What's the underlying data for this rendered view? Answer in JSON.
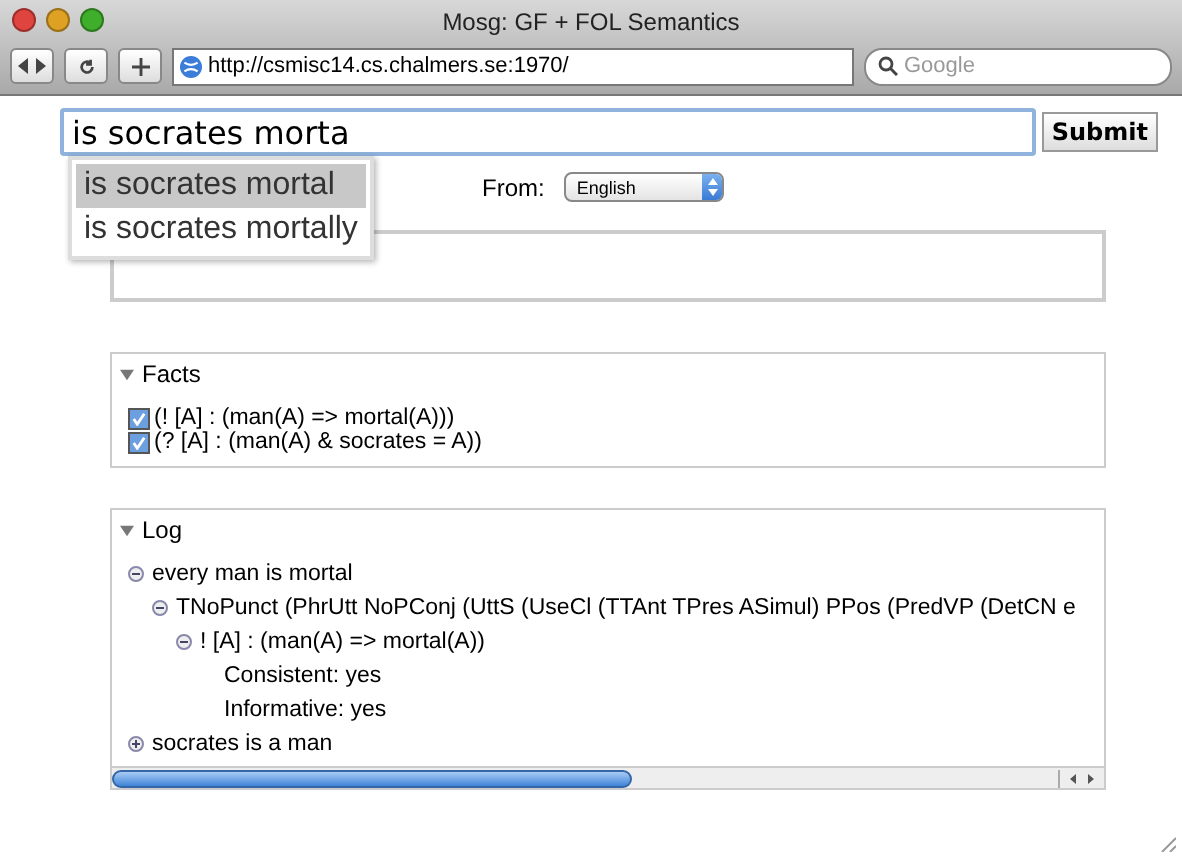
{
  "window": {
    "title": "Mosg: GF + FOL Semantics"
  },
  "toolbar": {
    "url": "http://csmisc14.cs.chalmers.se:1970/",
    "search": {
      "placeholder": "Google"
    }
  },
  "query": {
    "value": "is socrates morta",
    "submit": "Submit"
  },
  "suggestions": [
    {
      "text": "is socrates mortal",
      "selected": true
    },
    {
      "text": "is socrates mortally",
      "selected": false
    }
  ],
  "from": {
    "label": "From:",
    "value": "English"
  },
  "facts": {
    "title": "Facts",
    "expanded": true,
    "items": [
      {
        "text": "(! [A] : (man(A) => mortal(A)))",
        "checked": true
      },
      {
        "text": "(? [A] : (man(A) & socrates = A))",
        "checked": true
      }
    ]
  },
  "log": {
    "title": "Log",
    "expanded": true,
    "items": [
      {
        "text": "every man is mortal",
        "expanded": true,
        "children": [
          {
            "text": "TNoPunct (PhrUtt NoPConj (UttS (UseCl (TTAnt TPres ASimul) PPos (PredVP (DetCN e",
            "expanded": true,
            "children": [
              {
                "text": "! [A] : (man(A) => mortal(A))",
                "expanded": true,
                "children": [
                  {
                    "text": "Consistent: yes"
                  },
                  {
                    "text": "Informative: yes"
                  }
                ]
              }
            ]
          }
        ]
      },
      {
        "text": "socrates is a man",
        "expanded": false
      }
    ]
  }
}
